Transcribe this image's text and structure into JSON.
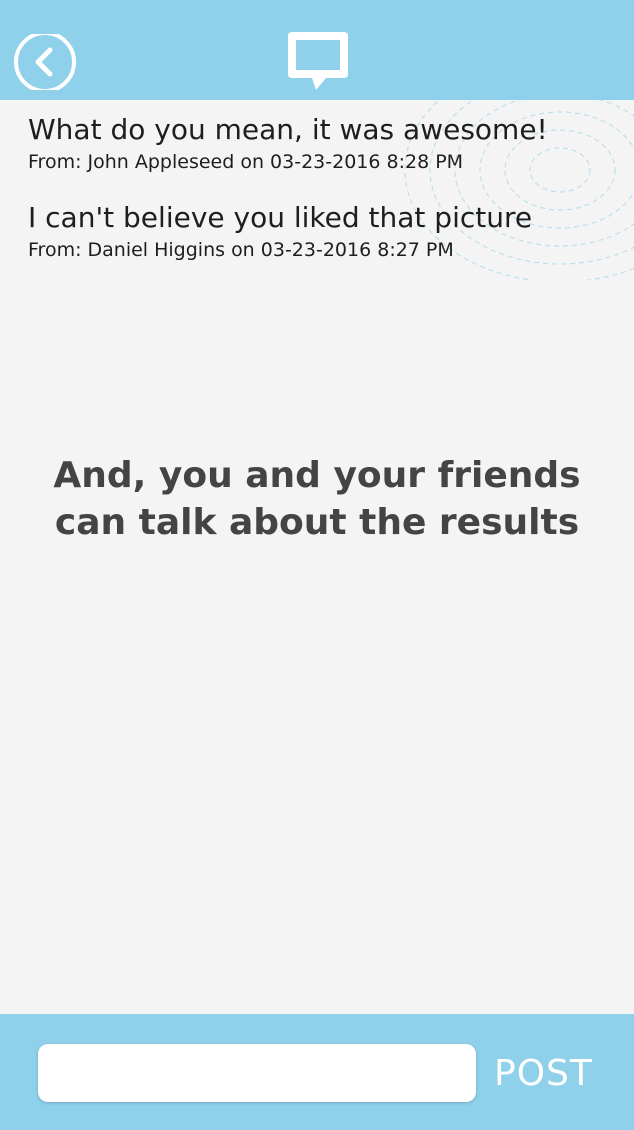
{
  "header": {
    "back_icon": "back-chevron-circle-icon",
    "title_icon": "chat-bubble-icon",
    "background_color": "#8fd0ea"
  },
  "messages": [
    {
      "text": "What do you mean, it was awesome!",
      "meta": "From: John Appleseed on 03-23-2016 8:28 PM"
    },
    {
      "text": "I can't believe you liked that picture",
      "meta": "From: Daniel Higgins on 03-23-2016 8:27 PM"
    }
  ],
  "caption": {
    "line1": "And, you and your friends",
    "line2": "can talk about the results"
  },
  "footer": {
    "input_value": "",
    "input_placeholder": "",
    "post_label": "POST"
  }
}
